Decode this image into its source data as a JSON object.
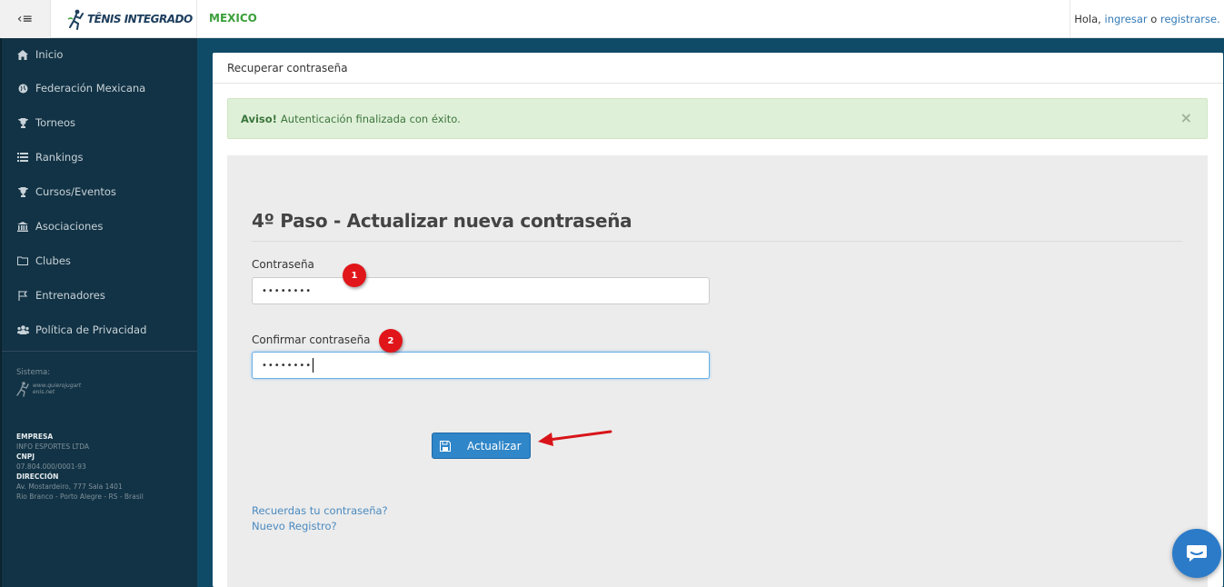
{
  "topbar": {
    "menu_icon": "arrow-left-bars-icon",
    "logo_text": "TÊNIS INTEGRADO",
    "country": "MEXICO",
    "greeting": "Hola,",
    "login_link": "ingresar",
    "separator": "o",
    "register_link": "registrarse."
  },
  "sidebar": {
    "items": [
      {
        "label": "Inicio",
        "icon": "home-icon"
      },
      {
        "label": "Federación Mexicana",
        "icon": "globe-icon"
      },
      {
        "label": "Torneos",
        "icon": "trophy-icon"
      },
      {
        "label": "Rankings",
        "icon": "list-icon"
      },
      {
        "label": "Cursos/Eventos",
        "icon": "trophy-icon"
      },
      {
        "label": "Asociaciones",
        "icon": "institution-icon"
      },
      {
        "label": "Clubes",
        "icon": "folder-icon"
      },
      {
        "label": "Entrenadores",
        "icon": "flag-icon"
      },
      {
        "label": "Política de Privacidad",
        "icon": "users-icon"
      }
    ],
    "system_label": "Sistema:",
    "system_logo_text": "www.quierojugartenis.net",
    "company": {
      "empresa_label": "EMPRESA",
      "empresa_value": "INFO ESPORTES LTDA",
      "cnpj_label": "CNPJ",
      "cnpj_value": "07.804.000/0001-93",
      "direccion_label": "DIRECCIÓN",
      "direccion_line1": "Av. Mostardeiro, 777 Sala 1401",
      "direccion_line2": "Rio Branco - Porto Alegre - RS - Brasil"
    }
  },
  "main": {
    "header_title": "Recuperar contraseña",
    "alert": {
      "strong": "Aviso!",
      "text": "Autenticación finalizada con éxito.",
      "close": "×"
    },
    "form": {
      "title": "4º Paso - Actualizar nueva contraseña",
      "password_label": "Contraseña",
      "password_value": "••••••••",
      "confirm_label": "Confirmar contraseña",
      "confirm_value": "••••••••",
      "submit_label": "Actualizar",
      "submit_icon": "floppy-disk-icon"
    },
    "annotations": {
      "badge1": "1",
      "badge2": "2"
    },
    "links": {
      "forgot": "Recuerdas tu contraseña?",
      "register": "Nuevo Registro?"
    }
  },
  "chat": {
    "icon": "chat-icon"
  }
}
